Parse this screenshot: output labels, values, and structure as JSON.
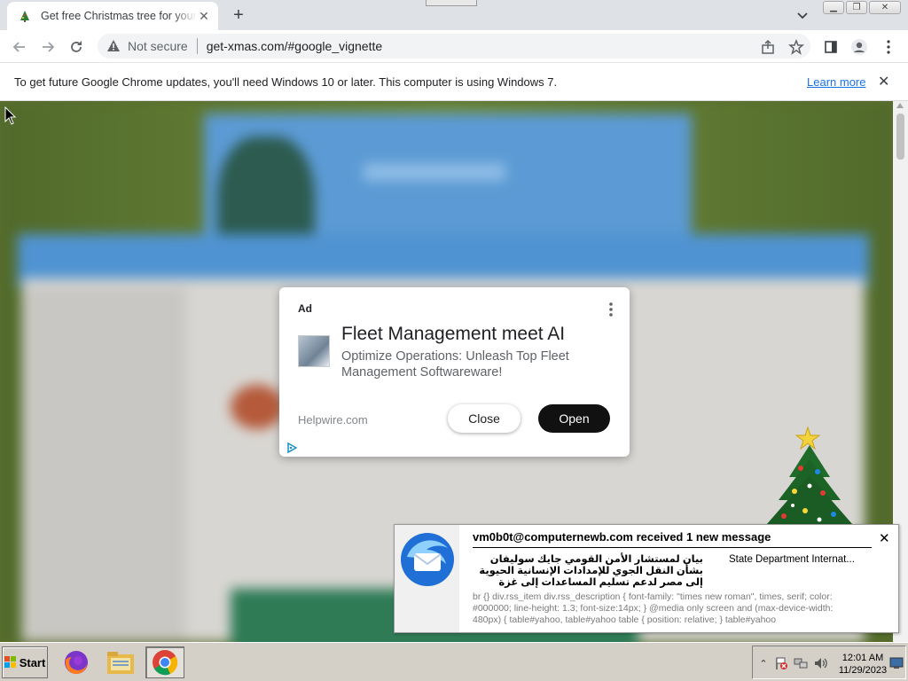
{
  "browser": {
    "tab_title": "Get free Christmas tree for your desktop",
    "new_tab_icon": "plus-icon",
    "url_security": "Not secure",
    "url": "get-xmas.com/#google_vignette"
  },
  "infobar": {
    "message": "To get future Google Chrome updates, you'll need Windows 10 or later. This computer is using Windows 7.",
    "learn_more": "Learn more"
  },
  "ad": {
    "label": "Ad",
    "headline": "Fleet Management meet AI",
    "description": "Optimize Operations: Unleash Top Fleet Management Softwareware!",
    "domain": "Helpwire.com",
    "close_label": "Close",
    "open_label": "Open"
  },
  "notification": {
    "heading": "vm0b0t@computernewb.com received 1 new message",
    "subject": "بيان لمستشار الأمن القومي جايك سوليفان بشأن النقل الجوي للإمدادات الإنسانية الحيوية إلى مصر لدعم تسليم المساعدات إلى غزة",
    "sender": "State Department Internat...",
    "preview": "br {} div.rss_item div.rss_description { font-family: \"times new roman\", times, serif; color: #000000; line-height: 1.3; font-size:14px; } @media only screen and (max-device-width: 480px) { table#yahoo, table#yahoo table { position: relative; } table#yahoo"
  },
  "taskbar": {
    "start_label": "Start",
    "time": "12:01 AM",
    "date": "11/29/2023"
  },
  "colors": {
    "page_bg": "#5a6d2d",
    "chrome_tabstrip": "#dee1e6",
    "link_blue": "#1a73e8",
    "taskbar": "#d4d0c8"
  }
}
